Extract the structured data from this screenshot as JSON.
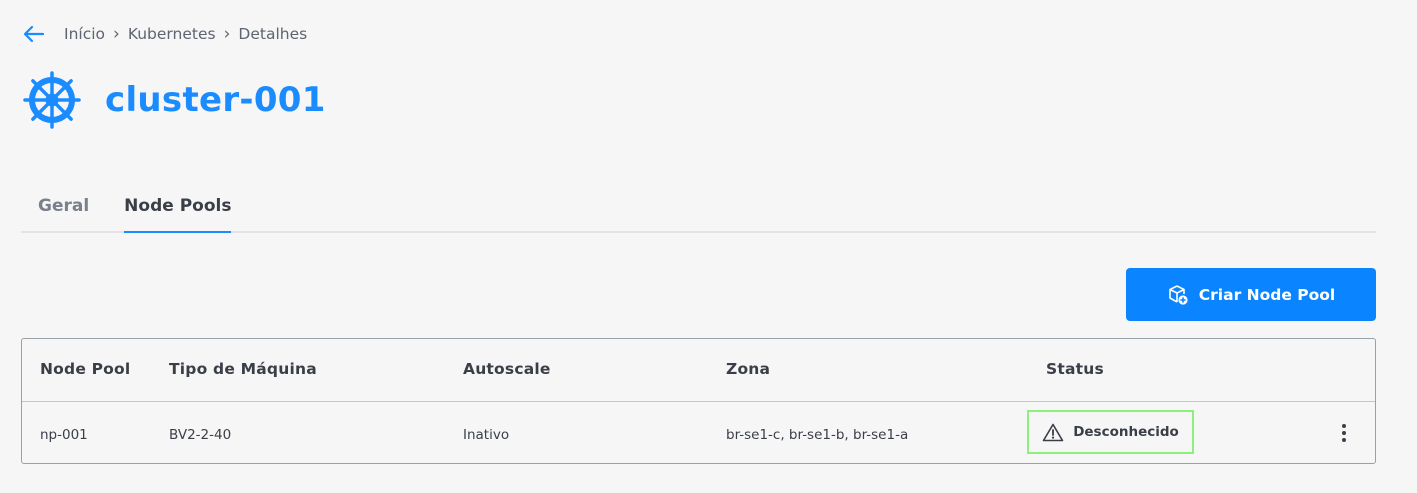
{
  "breadcrumb": {
    "items": [
      "Início",
      "Kubernetes",
      "Detalhes"
    ],
    "separator": "›"
  },
  "header": {
    "title": "cluster-001",
    "icon": "helm-wheel-icon"
  },
  "tabs": [
    {
      "label": "Geral",
      "active": false
    },
    {
      "label": "Node Pools",
      "active": true
    }
  ],
  "actions": {
    "create_label": "Criar Node Pool",
    "create_icon": "cube-plus-icon"
  },
  "table": {
    "columns": [
      "Node Pool",
      "Tipo de Máquina",
      "Autoscale",
      "Zona",
      "Status"
    ],
    "rows": [
      {
        "node_pool": "np-001",
        "machine_type": "BV2-2-40",
        "autoscale": "Inativo",
        "zone": "br-se1-c, br-se1-b, br-se1-a",
        "status": "Desconhecido",
        "status_icon": "warning-triangle-icon"
      }
    ]
  },
  "colors": {
    "accent": "#1a8cff",
    "button": "#0a84ff",
    "status_highlight": "#8df07a",
    "background": "#f6f6f6"
  }
}
